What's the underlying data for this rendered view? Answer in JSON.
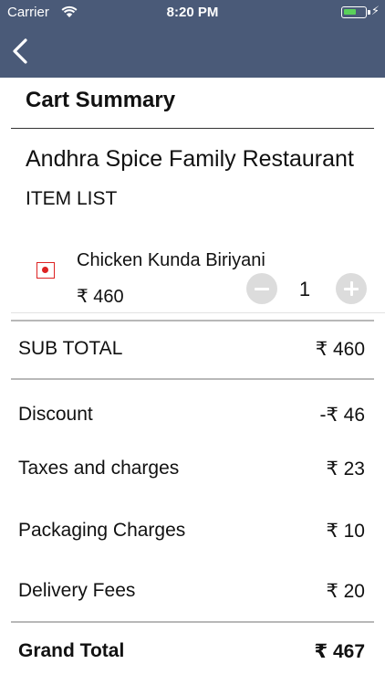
{
  "status_bar": {
    "carrier": "Carrier",
    "time": "8:20 PM",
    "charging_symbol": "⚡",
    "battery_level": 0.6
  },
  "nav": {
    "back_icon": "chevron-left-icon"
  },
  "page": {
    "title": "Cart Summary"
  },
  "restaurant": {
    "name": "Andhra Spice Family Restaurant"
  },
  "items_heading": "ITEM LIST",
  "items": [
    {
      "name": "Chicken Kunda Biriyani",
      "price": "₹ 460",
      "quantity": "1",
      "type_mark": "non-veg-mark",
      "type_color": "#dd2222"
    }
  ],
  "summary": {
    "subtotal": {
      "label": "SUB TOTAL",
      "value": "₹ 460"
    },
    "discount": {
      "label": "Discount",
      "value": "-₹ 46"
    },
    "taxes": {
      "label": "Taxes and charges",
      "value": "₹ 23"
    },
    "packaging": {
      "label": "Packaging Charges",
      "value": "₹ 10"
    },
    "delivery": {
      "label": "Delivery Fees",
      "value": "₹ 20"
    },
    "grand_total": {
      "label": "Grand Total",
      "value": "₹ 467"
    }
  },
  "colors": {
    "header": "#4a5a78",
    "qty_button": "#dcdcdc",
    "battery": "#5ad15a"
  }
}
